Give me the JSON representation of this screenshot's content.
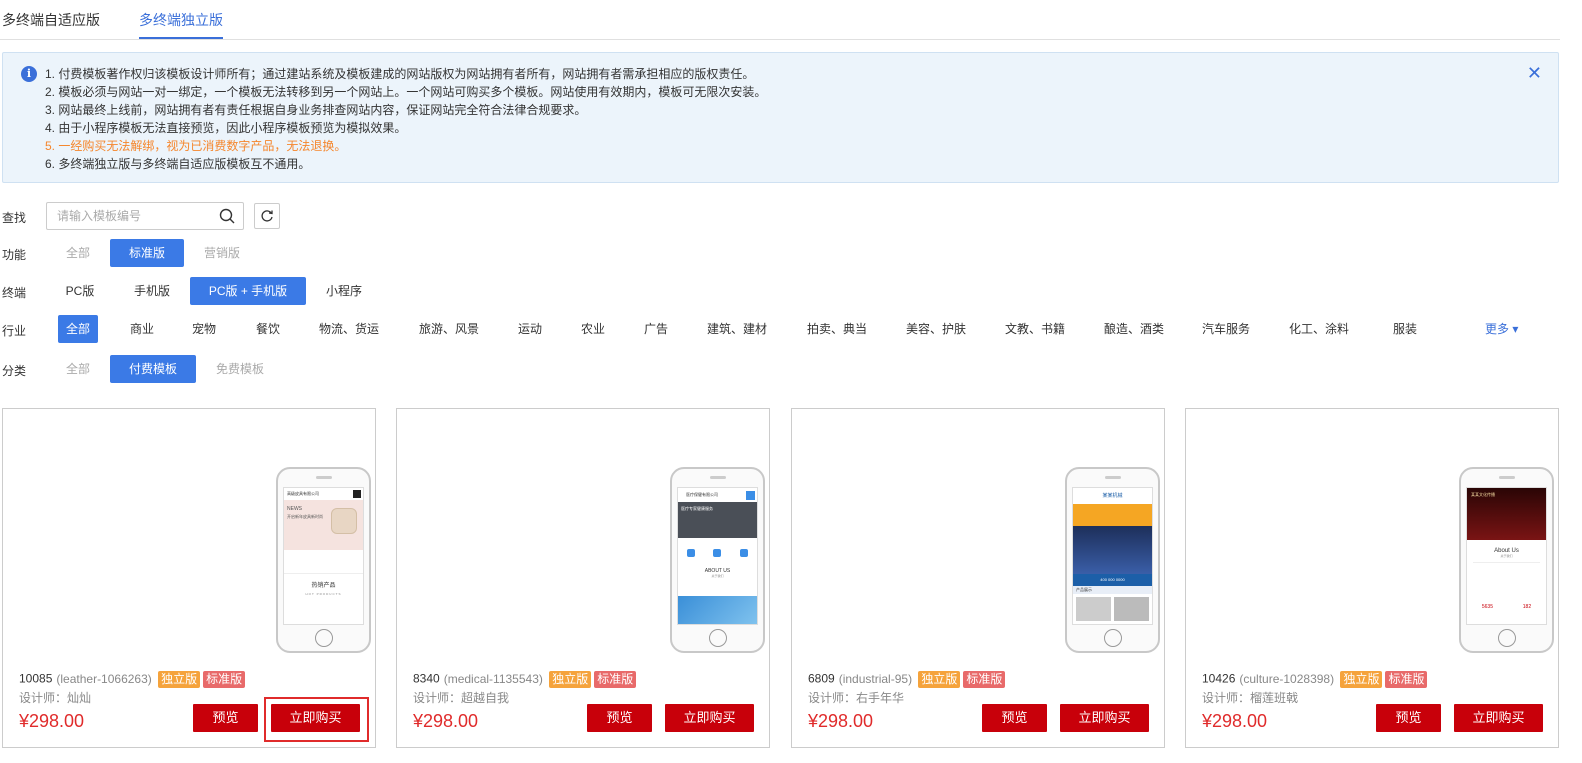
{
  "tabs": [
    {
      "label": "多终端自适应版"
    },
    {
      "label": "多终端独立版"
    }
  ],
  "notice": {
    "lines": [
      "1. 付费模板著作权归该模板设计师所有；通过建站系统及模板建成的网站版权为网站拥有者所有，网站拥有者需承担相应的版权责任。",
      "2. 模板必须与网站一对一绑定，一个模板无法转移到另一个网站上。一个网站可购买多个模板。网站使用有效期内，模板可无限次安装。",
      "3. 网站最终上线前，网站拥有者有责任根据自身业务排查网站内容，保证网站完全符合法律合规要求。",
      "4. 由于小程序模板无法直接预览，因此小程序模板预览为模拟效果。",
      "5. 一经购买无法解绑，视为已消费数字产品，无法退换。",
      "6. 多终端独立版与多终端自适应版模板互不通用。"
    ],
    "accent_color": "#3a6fd9",
    "warning_color": "#f5862c"
  },
  "search": {
    "label": "查找",
    "placeholder": "请输入模板编号"
  },
  "filters": {
    "function": {
      "label": "功能",
      "options": [
        "全部",
        "标准版",
        "营销版"
      ]
    },
    "terminal": {
      "label": "终端",
      "options": [
        "PC版",
        "手机版",
        "PC版 + 手机版",
        "小程序"
      ]
    },
    "industry": {
      "label": "行业",
      "options": [
        "全部",
        "商业",
        "宠物",
        "餐饮",
        "物流、货运",
        "旅游、风景",
        "运动",
        "农业",
        "广告",
        "建筑、建材",
        "拍卖、典当",
        "美容、护肤",
        "文教、书籍",
        "酿造、酒类",
        "汽车服务",
        "化工、涂料",
        "服装"
      ],
      "more": "更多"
    },
    "category": {
      "label": "分类",
      "options": [
        "全部",
        "付费模板",
        "免费模板"
      ]
    }
  },
  "cards": [
    {
      "id": "10085",
      "code": "(leather-1066263)",
      "badge1": "独立版",
      "badge2": "标准版",
      "designer": "设计师：灿灿",
      "price": "¥298.00",
      "preview": "预览",
      "buy": "立即购买",
      "phone": {
        "company": "高级皮具有限公司",
        "news": "NEWS",
        "headline": "开启新年皮具新时尚",
        "section": "热销产品",
        "sub": "HOT PRODUCTS"
      }
    },
    {
      "id": "8340",
      "code": "(medical-1135543)",
      "badge1": "独立版",
      "badge2": "标准版",
      "designer": "设计师：超越自我",
      "price": "¥298.00",
      "preview": "预览",
      "buy": "立即购买",
      "phone": {
        "company": "医疗保健有限公司",
        "headline": "医疗专家健康服务",
        "section": "ABOUT US",
        "sub": "关于我们"
      }
    },
    {
      "id": "6809",
      "code": "(industrial-95)",
      "badge1": "独立版",
      "badge2": "标准版",
      "designer": "设计师：右手年华",
      "price": "¥298.00",
      "preview": "预览",
      "buy": "立即购买",
      "phone": {
        "company": "某某机械",
        "phone_line": "400 000 0000",
        "section": "产品展示"
      }
    },
    {
      "id": "10426",
      "code": "(culture-1028398)",
      "badge1": "独立版",
      "badge2": "标准版",
      "designer": "设计师：榴莲班戟",
      "price": "¥298.00",
      "preview": "预览",
      "buy": "立即购买",
      "phone": {
        "company": "某某文化传播",
        "section": "About Us",
        "sub": "关于我们",
        "stat1": "5635",
        "stat2": "182"
      }
    }
  ],
  "colors": {
    "active": "#3b7ae6",
    "button": "#c8000a",
    "price": "#e02b2b",
    "badge_orange": "#f5a33c",
    "badge_red": "#e86a6a"
  }
}
